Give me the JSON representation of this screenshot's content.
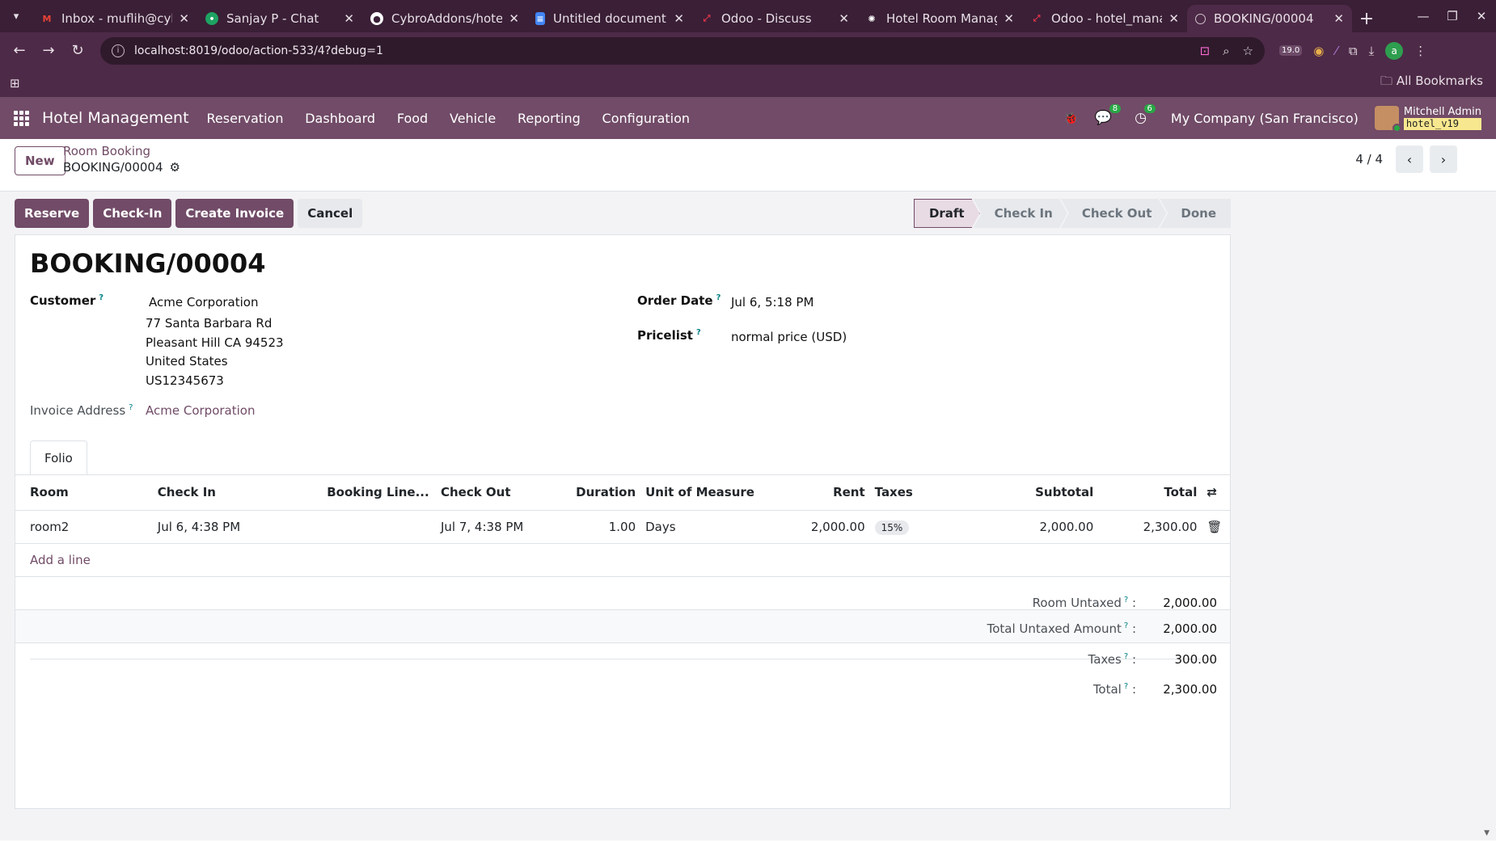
{
  "browser": {
    "tabs": [
      {
        "title": "Inbox - muflih@cyb",
        "icon": "gmail-icon",
        "color": "#ea4335"
      },
      {
        "title": "Sanjay P - Chat",
        "icon": "chat-icon",
        "color": "#1ea362"
      },
      {
        "title": "CybroAddons/hotel",
        "icon": "github-icon",
        "color": "#ffffff"
      },
      {
        "title": "Untitled document",
        "icon": "docs-icon",
        "color": "#4285f4"
      },
      {
        "title": "Odoo - Discuss",
        "icon": "odoo-icon",
        "color": "#e2344a"
      },
      {
        "title": "Hotel Room Manag",
        "icon": "chatgpt-icon",
        "color": "#ffffff"
      },
      {
        "title": "Odoo - hotel_mana",
        "icon": "odoo-icon",
        "color": "#e2344a"
      },
      {
        "title": "BOOKING/00004",
        "icon": "loading-icon",
        "color": "#cfc1cc",
        "active": true
      }
    ],
    "url": "localhost:8019/odoo/action-533/4?debug=1",
    "extension_badge": "19.0",
    "profile_initial": "a",
    "bookmarks_label": "All Bookmarks"
  },
  "navbar": {
    "app_name": "Hotel Management",
    "menu": [
      "Reservation",
      "Dashboard",
      "Food",
      "Vehicle",
      "Reporting",
      "Configuration"
    ],
    "messages_count": "8",
    "activities_count": "6",
    "company": "My Company (San Francisco)",
    "user_name": "Mitchell Admin",
    "database": "hotel_v19"
  },
  "control": {
    "new_label": "New",
    "breadcrumb_parent": "Room Booking",
    "breadcrumb_current": "BOOKING/00004",
    "pager": "4 / 4"
  },
  "actions": {
    "reserve": "Reserve",
    "checkin": "Check-In",
    "create_invoice": "Create Invoice",
    "cancel": "Cancel"
  },
  "stages": [
    "Draft",
    "Check In",
    "Check Out",
    "Done"
  ],
  "form": {
    "title": "BOOKING/00004",
    "customer_label": "Customer",
    "customer_name": "Acme Corporation",
    "customer_address": [
      "77 Santa Barbara Rd",
      "Pleasant Hill CA 94523",
      "United States",
      "US12345673"
    ],
    "invoice_address_label": "Invoice Address",
    "invoice_address": "Acme Corporation",
    "order_date_label": "Order Date",
    "order_date": "Jul 6, 5:18 PM",
    "pricelist_label": "Pricelist",
    "pricelist": "normal price (USD)",
    "tab_folio": "Folio"
  },
  "lines": {
    "columns": [
      "Room",
      "Check In",
      "Booking Line...",
      "Check Out",
      "Duration",
      "Unit of Measure",
      "Rent",
      "Taxes",
      "Subtotal",
      "Total"
    ],
    "rows": [
      {
        "room": "room2",
        "check_in": "Jul 6, 4:38 PM",
        "booking_line": "",
        "check_out": "Jul 7, 4:38 PM",
        "duration": "1.00",
        "uom": "Days",
        "rent": "2,000.00",
        "taxes": "15%",
        "subtotal": "2,000.00",
        "total": "2,300.00"
      }
    ],
    "add_line": "Add a line"
  },
  "totals": {
    "room_untaxed_label": "Room Untaxed",
    "room_untaxed": "2,000.00",
    "total_untaxed_label": "Total Untaxed Amount",
    "total_untaxed": "2,000.00",
    "taxes_label": "Taxes",
    "taxes": "300.00",
    "total_label": "Total",
    "total": "2,300.00"
  }
}
